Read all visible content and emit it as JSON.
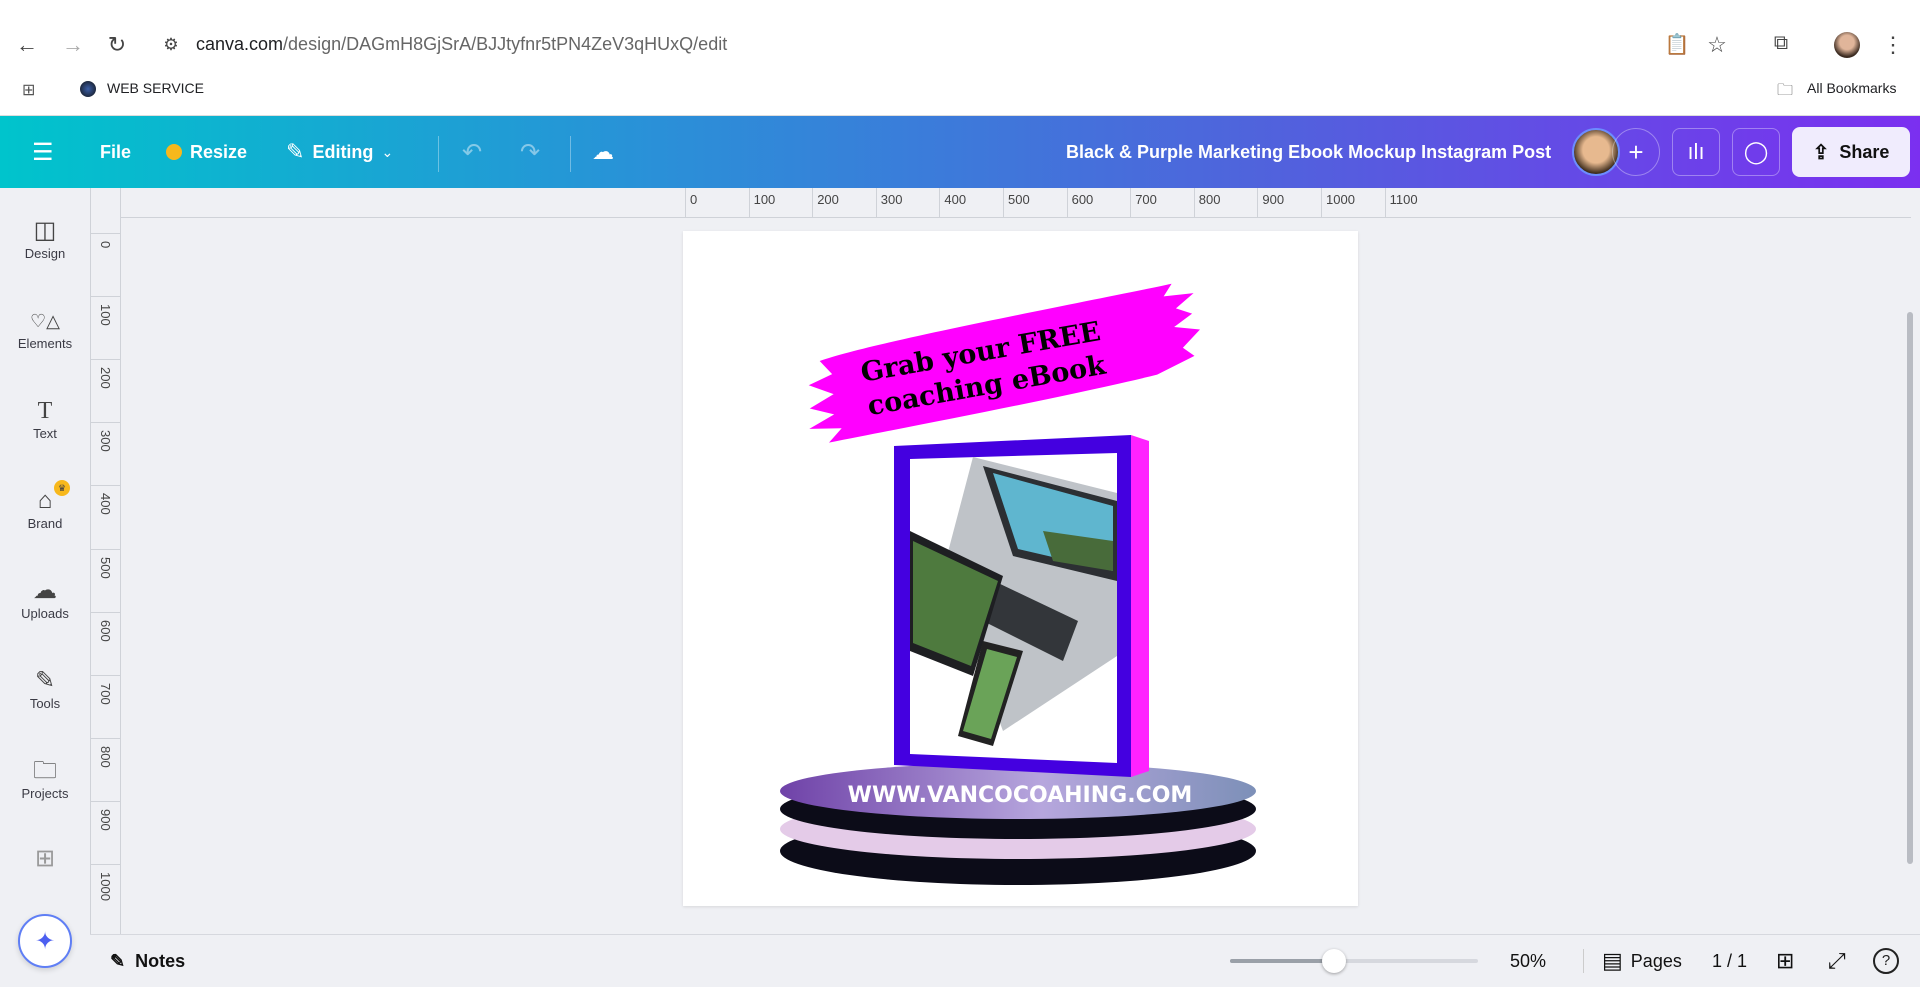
{
  "browser": {
    "url_domain": "canva.com",
    "url_path": "/design/DAGmH8GjSrA/BJJtyfnr5tPN4ZeV3qHUxQ/edit",
    "bookmark": "WEB SERVICE",
    "all_bookmarks": "All Bookmarks",
    "icons": [
      "back-icon",
      "forward-icon",
      "reload-icon",
      "site-settings-icon",
      "clipboard-icon",
      "star-icon",
      "extensions-icon",
      "profile-avatar",
      "menu-icon"
    ]
  },
  "header": {
    "file": "File",
    "resize": "Resize",
    "editing": "Editing",
    "title": "Black & Purple Marketing Ebook Mockup Instagram Post",
    "share": "Share",
    "gradient": [
      "#00c4cc",
      "#7b2ff0"
    ]
  },
  "sidebar": {
    "items": [
      {
        "label": "Design",
        "icon": "◫"
      },
      {
        "label": "Elements",
        "icon": "♡△"
      },
      {
        "label": "Text",
        "icon": "T"
      },
      {
        "label": "Brand",
        "icon": "☁"
      },
      {
        "label": "Uploads",
        "icon": "☁"
      },
      {
        "label": "Tools",
        "icon": "✎"
      },
      {
        "label": "Projects",
        "icon": "▭"
      }
    ]
  },
  "rulers": {
    "horizontal": [
      "0",
      "100",
      "200",
      "300",
      "400",
      "500",
      "600",
      "700",
      "800",
      "900",
      "1000",
      "1100"
    ],
    "vertical": [
      "0",
      "100",
      "200",
      "300",
      "400",
      "500",
      "600",
      "700",
      "800",
      "900",
      "1000"
    ]
  },
  "design": {
    "banner_line1": "Grab your FREE",
    "banner_line2": "coaching eBook",
    "url_text": "WWW.VANCOCOAHING.COM",
    "colors": {
      "banner": "#ff00ff",
      "book_frame": "#4400e0",
      "book_spine": "#ff22ff",
      "podium_top": "#7b4fb5",
      "podium_band": "#e4cbe8"
    }
  },
  "footer": {
    "notes": "Notes",
    "zoom_value": "50%",
    "zoom_fraction": 0.42,
    "pages": "Pages",
    "page_count": "1 / 1"
  }
}
